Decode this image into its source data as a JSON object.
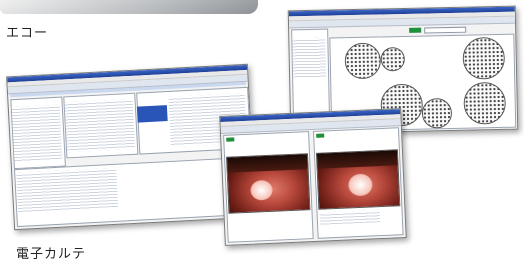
{
  "captions": {
    "echo": "エコー",
    "emr": "電子カルテ"
  },
  "icons": [
    "echo-device-photo",
    "eye-photo"
  ]
}
